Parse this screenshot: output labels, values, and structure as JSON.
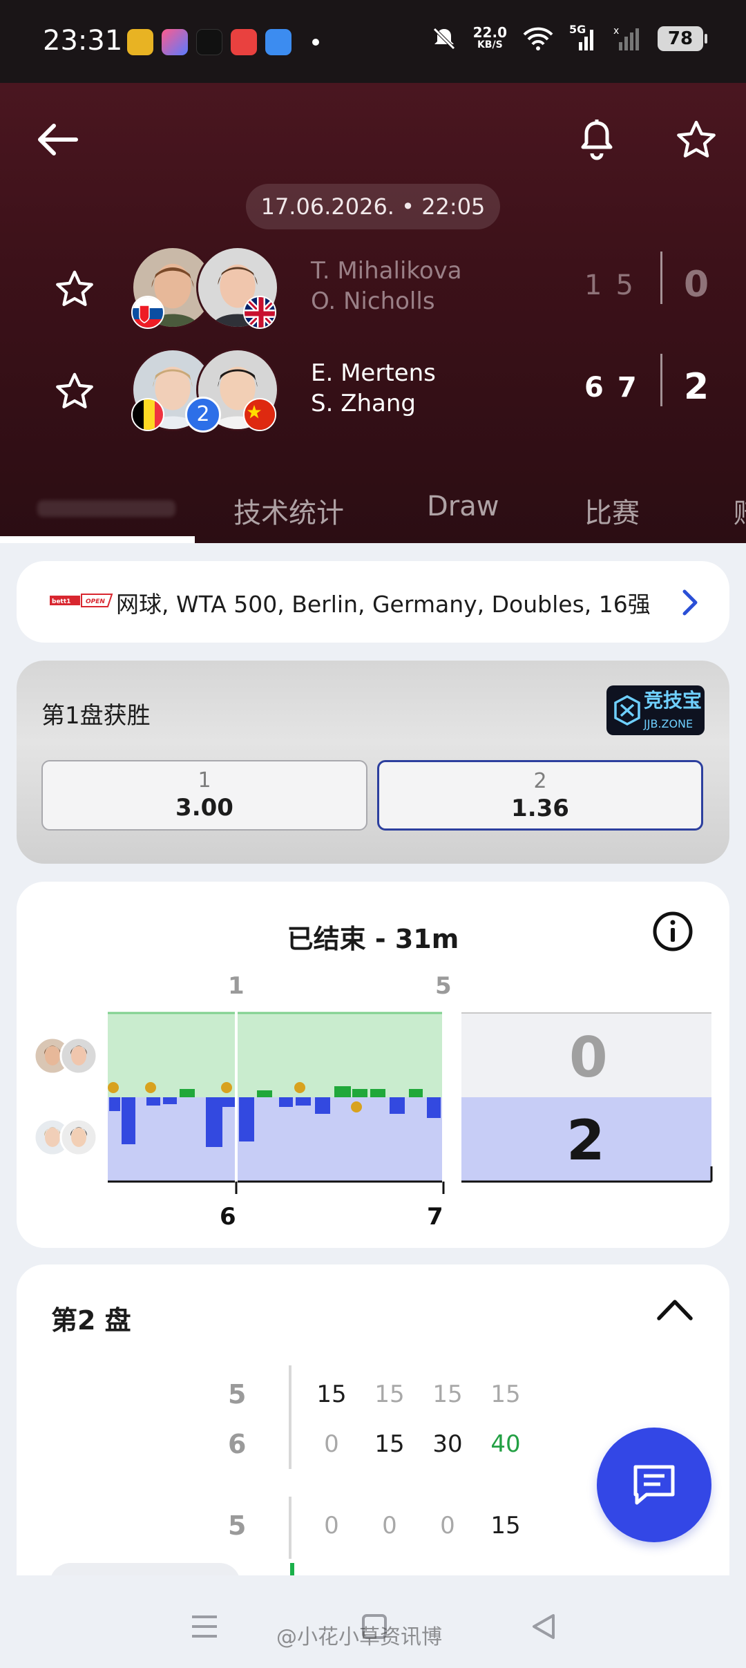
{
  "status_bar": {
    "time": "23:31",
    "net_speed": "22.0",
    "net_unit": "KB/S",
    "network": "5G",
    "battery": "78"
  },
  "header": {
    "datetime": "17.06.2026. • 22:05",
    "team1": {
      "player1": "T. Mihalikova",
      "player2": "O. Nicholls",
      "set1": "1",
      "set2": "5",
      "sets_won": "0",
      "flags": [
        "Slovakia",
        "United Kingdom"
      ]
    },
    "team2": {
      "player1": "E. Mertens",
      "player2": "S. Zhang",
      "set1": "6",
      "set2": "7",
      "sets_won": "2",
      "seed": "2",
      "flags": [
        "Belgium",
        "China"
      ]
    },
    "tabs": [
      "技术统计",
      "Draw",
      "比赛",
      "赔"
    ]
  },
  "league": {
    "logo_text": "bett1 OPEN",
    "text": "网球, WTA 500, Berlin, Germany, Doubles, 16强"
  },
  "odds": {
    "title": "第1盘获胜",
    "sponsor_cn": "竞技宝",
    "sponsor_en": "JJB.ZONE",
    "options": [
      {
        "label": "1",
        "value": "3.00",
        "selected": false
      },
      {
        "label": "2",
        "value": "1.36",
        "selected": true
      }
    ]
  },
  "momentum": {
    "title": "已结束 - 31m",
    "team1_set_scores": [
      "1",
      "5"
    ],
    "team2_set_scores": [
      "6",
      "7"
    ],
    "team1_total": "0",
    "team2_total": "2",
    "colors": {
      "team1": "#c9ecce",
      "team2": "#c7cdf6",
      "team1_bar": "#20a83a",
      "team2_bar": "#3349e0",
      "break": "#d8a21e"
    }
  },
  "set_detail": {
    "title": "第2 盘",
    "games": [
      {
        "team1_games": "5",
        "team2_games": "6",
        "team1_points": [
          "15",
          "15",
          "15",
          "15"
        ],
        "team2_points": [
          "0",
          "15",
          "30",
          "40"
        ]
      },
      {
        "team1_games": "5",
        "team1_points": [
          "0",
          "0",
          "0",
          "15"
        ]
      }
    ]
  },
  "watermark": "@小花小草资讯博"
}
